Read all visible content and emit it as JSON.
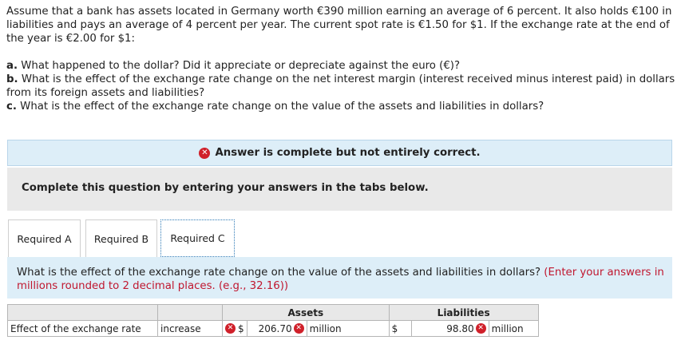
{
  "question": {
    "intro": "Assume that a bank has assets located in Germany worth €390 million earning an average of 6 percent. It also holds €100 in liabilities and pays an average of 4 percent per year. The current spot rate is €1.50 for $1. If the exchange rate at the end of the year is €2.00 for $1:",
    "parts": [
      {
        "letter": "a.",
        "text": "What happened to the dollar? Did it appreciate or depreciate against the euro (€)?"
      },
      {
        "letter": "b.",
        "text": "What is the effect of the exchange rate change on the net interest margin (interest received minus interest paid) in dollars from its foreign assets and liabilities?"
      },
      {
        "letter": "c.",
        "text": "What is the effect of the exchange rate change on the value of the assets and liabilities in dollars?"
      }
    ]
  },
  "banner": {
    "icon": "x-circle-icon",
    "text": "Answer is complete but not entirely correct."
  },
  "instruction": "Complete this question by entering your answers in the tabs below.",
  "tabs": [
    {
      "label": "Required A"
    },
    {
      "label": "Required B"
    },
    {
      "label": "Required C",
      "active": true
    }
  ],
  "panel": {
    "prompt": "What is the effect of the exchange rate change on the value of the assets and liabilities in dollars?",
    "hint": "(Enter your answers in millions rounded to 2 decimal places. (e.g., 32.16))"
  },
  "table": {
    "headers": {
      "assets": "Assets",
      "liabilities": "Liabilities"
    },
    "row": {
      "label": "Effect of the exchange rate",
      "direction": "increase",
      "assets_currency": "$",
      "assets_value": "206.70",
      "assets_unit": "million",
      "liabilities_currency": "$",
      "liabilities_value": "98.80",
      "liabilities_unit": "million"
    }
  },
  "colors": {
    "error_red": "#d0202a",
    "banner_bg": "#ddeef8",
    "hint_red": "#c0172f",
    "active_tab_border": "#2f7ab6"
  }
}
